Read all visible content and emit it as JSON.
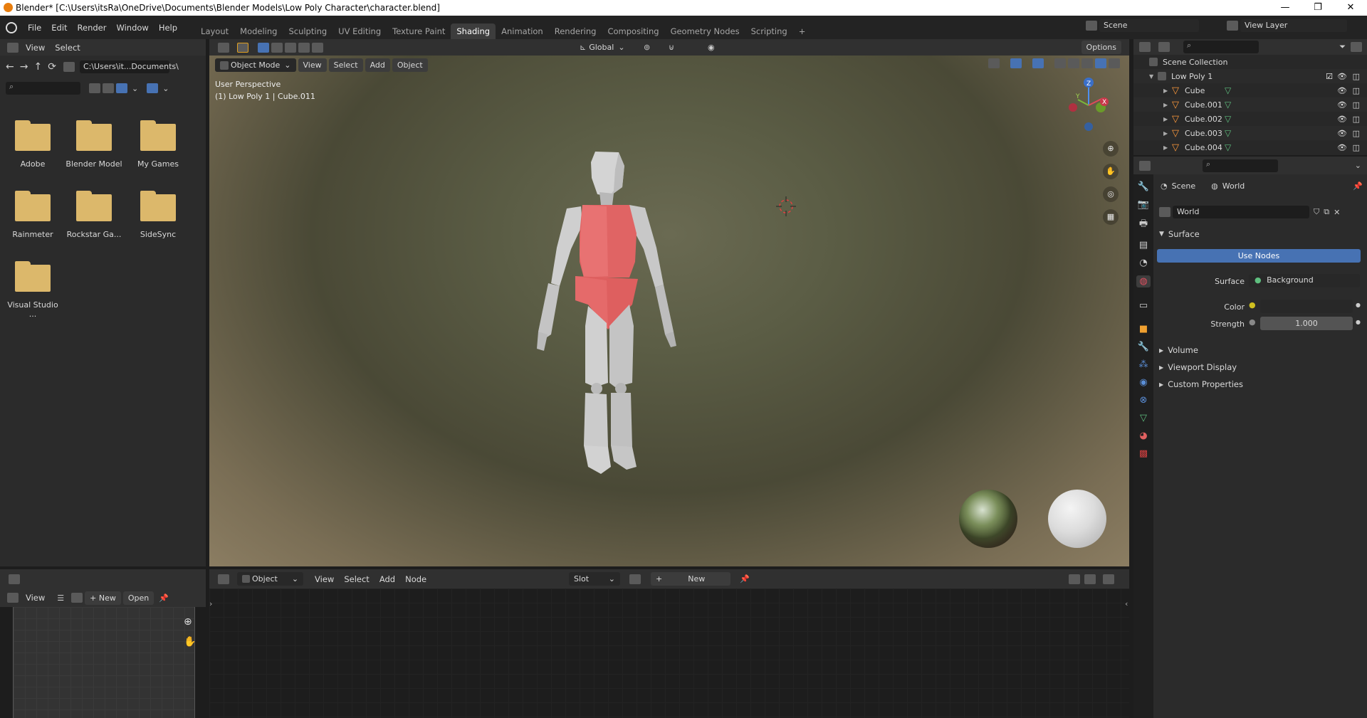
{
  "window": {
    "title": "Blender* [C:\\Users\\itsRa\\OneDrive\\Documents\\Blender Models\\Low Poly Character\\character.blend]",
    "minimize": "—",
    "maximize": "❐",
    "close": "✕"
  },
  "menu": [
    "File",
    "Edit",
    "Render",
    "Window",
    "Help"
  ],
  "workspaces": [
    "Layout",
    "Modeling",
    "Sculpting",
    "UV Editing",
    "Texture Paint",
    "Shading",
    "Animation",
    "Rendering",
    "Compositing",
    "Geometry Nodes",
    "Scripting"
  ],
  "active_workspace": "Shading",
  "scene_name": "Scene",
  "view_layer": "View Layer",
  "file_browser": {
    "menus": [
      "View",
      "Select"
    ],
    "path": "C:\\Users\\it...Documents\\",
    "folders": [
      "Adobe",
      "Blender Model",
      "My Games",
      "Rainmeter",
      "Rockstar Ga...",
      "SideSync",
      "Visual Studio ..."
    ]
  },
  "viewport": {
    "mode": "Object Mode",
    "menus": [
      "View",
      "Select",
      "Add",
      "Object"
    ],
    "transform": "Global",
    "options": "Options",
    "info_line1": "User Perspective",
    "info_line2": "(1) Low Poly 1 | Cube.011",
    "gizmo_z": "Z",
    "gizmo_y": "Y",
    "gizmo_x": "X"
  },
  "outliner": {
    "root": "Scene Collection",
    "collection": "Low Poly 1",
    "objects": [
      "Cube",
      "Cube.001",
      "Cube.002",
      "Cube.003",
      "Cube.004"
    ]
  },
  "properties": {
    "scene_crumb": "Scene",
    "world_crumb": "World",
    "world_name": "World",
    "surface_section": "Surface",
    "use_nodes": "Use Nodes",
    "surface_label": "Surface",
    "surface_value": "Background",
    "color_label": "Color",
    "strength_label": "Strength",
    "strength_value": "1.000",
    "sections": [
      "Volume",
      "Viewport Display",
      "Custom Properties"
    ]
  },
  "node_editor": {
    "type": "Object",
    "menus": [
      "View",
      "Select",
      "Add",
      "Node"
    ],
    "slot": "Slot",
    "new_label": "New"
  },
  "image_editor": {
    "view": "View",
    "new_label": "New",
    "open_label": "Open"
  },
  "colors": {
    "accent": "#4772b3",
    "body_red": "#e26565",
    "mesh_gray": "#c8c8c8"
  }
}
